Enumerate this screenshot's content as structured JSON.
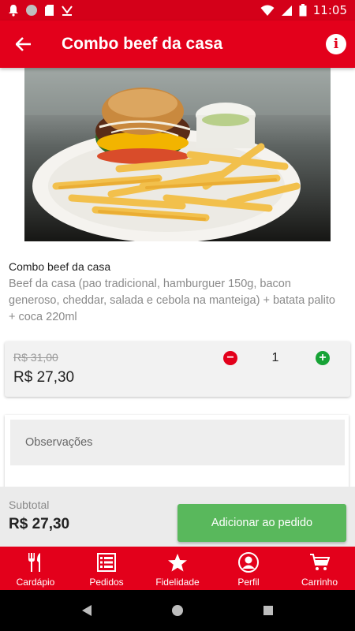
{
  "status_bar": {
    "time": "11:05",
    "icons": [
      "notification-bell-icon",
      "circle-icon",
      "sd-card-icon",
      "download-check-icon",
      "wifi-icon",
      "signal-icon",
      "battery-icon"
    ]
  },
  "app_bar": {
    "title": "Combo beef da casa",
    "back_icon": "arrow-left-icon",
    "info_icon": "info-icon",
    "info_glyph": "i"
  },
  "product": {
    "name": "Combo beef da casa",
    "description": "Beef da casa (pao tradicional,  hamburguer 150g,  bacon generoso,  cheddar,  salada e cebola na manteiga)  + batata palito + coca 220ml"
  },
  "price": {
    "old": "R$ 31,00",
    "current": "R$ 27,30",
    "quantity": "1",
    "minus_glyph": "−",
    "plus_glyph": "+"
  },
  "observations": {
    "placeholder": "Observações"
  },
  "footer": {
    "subtotal_label": "Subtotal",
    "subtotal_value": "R$ 27,30",
    "add_button": "Adicionar ao pedido"
  },
  "bottom_nav": {
    "items": [
      {
        "label": "Cardápio",
        "icon": "fork-knife-icon"
      },
      {
        "label": "Pedidos",
        "icon": "list-icon"
      },
      {
        "label": "Fidelidade",
        "icon": "star-icon"
      },
      {
        "label": "Perfil",
        "icon": "user-icon"
      },
      {
        "label": "Carrinho",
        "icon": "cart-icon"
      }
    ]
  },
  "colors": {
    "primary": "#e3001b",
    "status_bar": "#d40019",
    "add_button": "#59b85c",
    "plus": "#17a336"
  }
}
